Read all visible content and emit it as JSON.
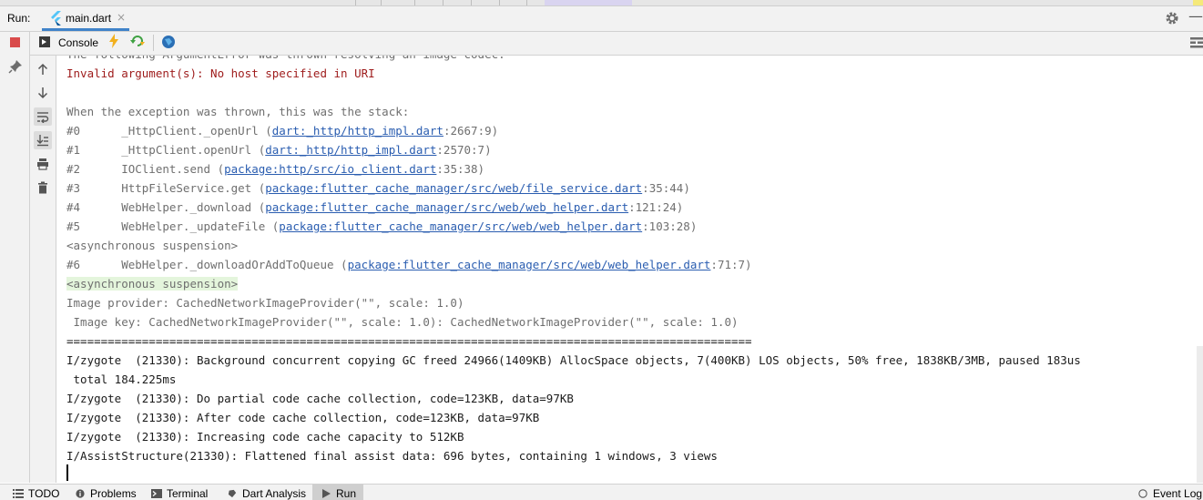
{
  "header": {
    "run_label": "Run:",
    "tab_name": "main.dart",
    "tab_close": "×",
    "minimize": "—"
  },
  "toolbar": {
    "console_label": "Console"
  },
  "console": {
    "lines": [
      {
        "segments": [
          {
            "text": "The following ArgumentError was thrown resolving an image codec:"
          }
        ]
      },
      {
        "segments": [
          {
            "text": "Invalid argument(s): No host specified in URI"
          }
        ]
      },
      {
        "segments": [
          {
            "text": ""
          }
        ]
      },
      {
        "segments": [
          {
            "text": "When the exception was thrown, this was the stack:"
          }
        ]
      },
      {
        "segments": [
          {
            "text": "#0      _HttpClient._openUrl ("
          },
          {
            "text": "dart:_http/http_impl.dart"
          },
          {
            "text": ":2667:9)"
          }
        ]
      },
      {
        "segments": [
          {
            "text": "#1      _HttpClient.openUrl ("
          },
          {
            "text": "dart:_http/http_impl.dart"
          },
          {
            "text": ":2570:7)"
          }
        ]
      },
      {
        "segments": [
          {
            "text": "#2      IOClient.send ("
          },
          {
            "text": "package:http/src/io_client.dart"
          },
          {
            "text": ":35:38)"
          }
        ]
      },
      {
        "segments": [
          {
            "text": "#3      HttpFileService.get ("
          },
          {
            "text": "package:flutter_cache_manager/src/web/file_service.dart"
          },
          {
            "text": ":35:44)"
          }
        ]
      },
      {
        "segments": [
          {
            "text": "#4      WebHelper._download ("
          },
          {
            "text": "package:flutter_cache_manager/src/web/web_helper.dart"
          },
          {
            "text": ":121:24)"
          }
        ]
      },
      {
        "segments": [
          {
            "text": "#5      WebHelper._updateFile ("
          },
          {
            "text": "package:flutter_cache_manager/src/web/web_helper.dart"
          },
          {
            "text": ":103:28)"
          }
        ]
      },
      {
        "segments": [
          {
            "text": "<asynchronous suspension>"
          }
        ]
      },
      {
        "segments": [
          {
            "text": "#6      WebHelper._downloadOrAddToQueue ("
          },
          {
            "text": "package:flutter_cache_manager/src/web/web_helper.dart"
          },
          {
            "text": ":71:7)"
          }
        ]
      },
      {
        "segments": [
          {
            "text": "<asynchronous suspension>"
          }
        ]
      },
      {
        "segments": [
          {
            "text": "Image provider: CachedNetworkImageProvider(\"\", scale: 1.0)"
          }
        ]
      },
      {
        "segments": [
          {
            "text": " Image key: CachedNetworkImageProvider(\"\", scale: 1.0): CachedNetworkImageProvider(\"\", scale: 1.0)"
          }
        ]
      },
      {
        "segments": [
          {
            "text": "===================================================================================================="
          }
        ]
      },
      {
        "segments": [
          {
            "text": "I/zygote  (21330): Background concurrent copying GC freed 24966(1409KB) AllocSpace objects, 7(400KB) LOS objects, 50% free, 1838KB/3MB, paused 183us"
          }
        ]
      },
      {
        "segments": [
          {
            "text": " total 184.225ms"
          }
        ]
      },
      {
        "segments": [
          {
            "text": "I/zygote  (21330): Do partial code cache collection, code=123KB, data=97KB"
          }
        ]
      },
      {
        "segments": [
          {
            "text": "I/zygote  (21330): After code cache collection, code=123KB, data=97KB"
          }
        ]
      },
      {
        "segments": [
          {
            "text": "I/zygote  (21330): Increasing code cache capacity to 512KB"
          }
        ]
      },
      {
        "segments": [
          {
            "text": "I/AssistStructure(21330): Flattened final assist data: 696 bytes, containing 1 windows, 3 views"
          }
        ]
      }
    ]
  },
  "status_bar": {
    "todo": "TODO",
    "problems": "Problems",
    "terminal": "Terminal",
    "dart_analysis": "Dart Analysis",
    "run": "Run",
    "event_log": "Event Log"
  }
}
